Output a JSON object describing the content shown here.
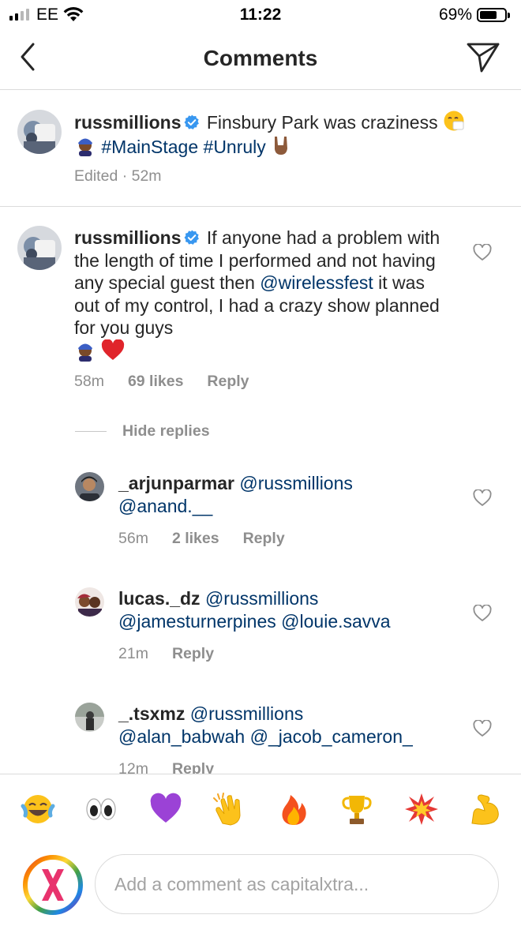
{
  "status_bar": {
    "carrier": "EE",
    "time": "11:22",
    "battery_percent_label": "69%",
    "battery_level": 0.69,
    "signal_bars": 4,
    "signal_bars_filled": 2
  },
  "header": {
    "title": "Comments",
    "back_icon": "chevron-left-icon",
    "send_icon": "direct-send-icon"
  },
  "caption": {
    "username": "russmillions",
    "verified": true,
    "text_before": "Finsbury Park was craziness",
    "hashtags": [
      "#MainStage",
      "#Unruly"
    ],
    "meta_time": "Edited · 52m"
  },
  "comment": {
    "username": "russmillions",
    "verified": true,
    "text_part1": "If anyone had a problem with the length of time I performed and not having any special guest then",
    "mention": "@wirelessfest",
    "text_part2": "it was out of my control, I had a crazy show planned for you guys",
    "time": "58m",
    "likes": "69 likes",
    "reply_label": "Reply"
  },
  "hide_replies_label": "Hide replies",
  "replies": [
    {
      "username": "_arjunparmar",
      "mentions": [
        "@russmillions",
        "@anand.__"
      ],
      "time": "56m",
      "likes": "2 likes",
      "reply_label": "Reply"
    },
    {
      "username": "lucas._dz",
      "mentions": [
        "@russmillions",
        "@jamesturnerpines",
        "@louie.savva"
      ],
      "time": "21m",
      "likes": "",
      "reply_label": "Reply"
    },
    {
      "username": "_.tsxmz",
      "mentions": [
        "@russmillions",
        "@alan_babwah",
        "@_jacob_cameron_"
      ],
      "time": "12m",
      "likes": "",
      "reply_label": "Reply"
    }
  ],
  "emoji_bar": [
    "face-with-tears-of-joy",
    "eyes",
    "purple-heart",
    "clapping-hands",
    "fire",
    "trophy",
    "collision",
    "flexed-biceps"
  ],
  "input": {
    "placeholder": "Add a comment as capitalxtra...",
    "value": ""
  },
  "colors": {
    "link": "#003569",
    "verified": "#3897f0",
    "meta": "#8e8e8e",
    "divider": "#dbdbdb"
  }
}
